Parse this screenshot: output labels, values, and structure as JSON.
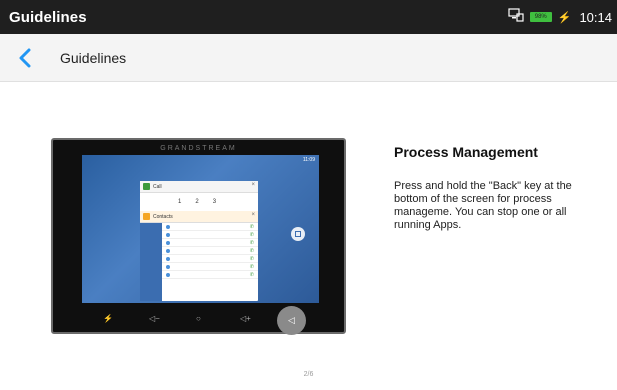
{
  "status_bar": {
    "title": "Guidelines",
    "time": "10:14",
    "battery": "98%"
  },
  "toolbar": {
    "title": "Guidelines"
  },
  "illustration": {
    "brand": "GRANDSTREAM",
    "screen_time": "11:09",
    "call_card_title": "Call",
    "contacts_card_title": "Contacts",
    "dialpad": [
      "1",
      "2",
      "3"
    ]
  },
  "guide": {
    "title": "Process Management",
    "body": "Press and hold the \"Back\" key at the bottom of the screen for process manageme. You can stop one or all running Apps."
  },
  "pager": {
    "text": "2/6"
  },
  "colors": {
    "accent": "#2196f3",
    "status_bar": "#1f1f1f",
    "battery": "#3fbf3f"
  }
}
